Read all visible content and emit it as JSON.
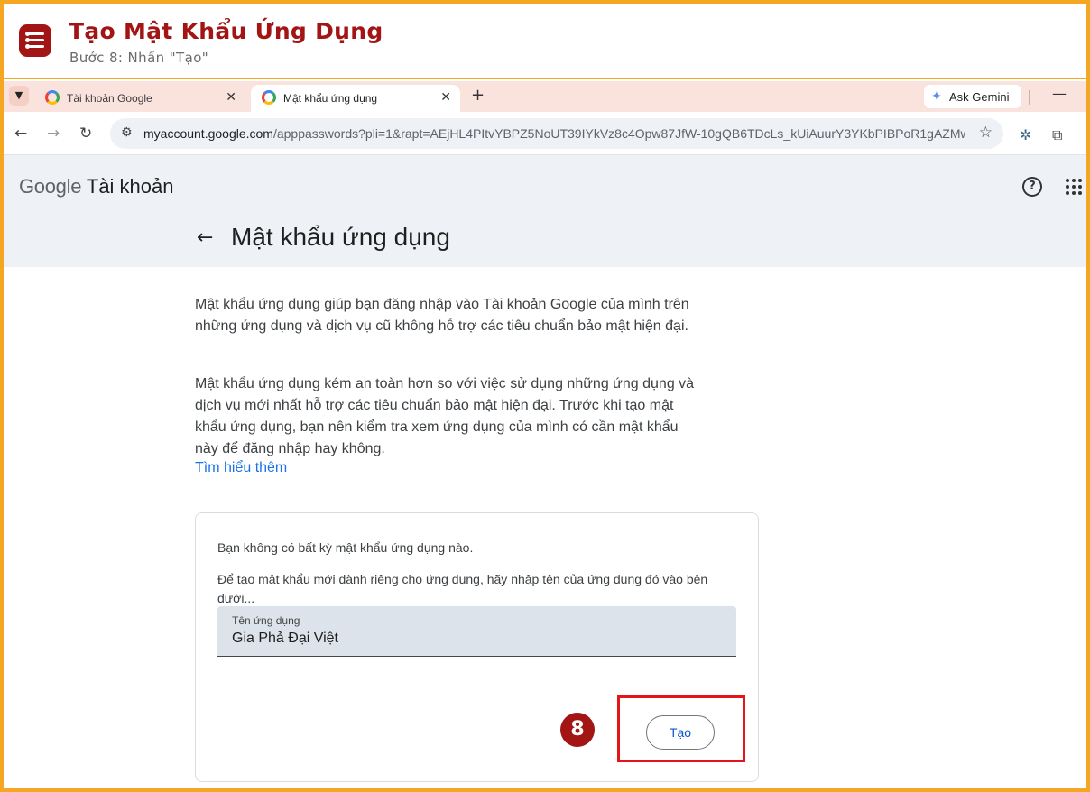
{
  "tutorial": {
    "title": "Tạo Mật Khẩu Ứng Dụng",
    "subtitle": "Bước 8: Nhấn \"Tạo\"",
    "step_number": "8"
  },
  "browser": {
    "tabs": [
      {
        "label": "Tài khoản Google",
        "close": "✕"
      },
      {
        "label": "Mật khẩu ứng dụng",
        "close": "✕"
      }
    ],
    "new_tab": "+",
    "gemini_label": "Ask Gemini",
    "minimize": "—",
    "url_host": "myaccount.google.com",
    "url_path": "/apppasswords?pli=1&rapt=AEjHL4PItvYBPZ5NoUT39IYkVz8c4Opw87JfW-10gQB6TDcLs_kUiAuurY3YKbPIBPoR1gAZMwQ..."
  },
  "header": {
    "brand_google": "Google",
    "brand_account": "Tài khoản",
    "help": "?"
  },
  "page": {
    "title": "Mật khẩu ứng dụng",
    "para1": "Mật khẩu ứng dụng giúp bạn đăng nhập vào Tài khoản Google của mình trên những ứng dụng và dịch vụ cũ không hỗ trợ các tiêu chuẩn bảo mật hiện đại.",
    "para2": "Mật khẩu ứng dụng kém an toàn hơn so với việc sử dụng những ứng dụng và dịch vụ mới nhất hỗ trợ các tiêu chuẩn bảo mật hiện đại. Trước khi tạo mật khẩu ứng dụng, bạn nên kiểm tra xem ứng dụng của mình có cần mật khẩu này để đăng nhập hay không.",
    "learn_more": "Tìm hiểu thêm"
  },
  "card": {
    "no_passwords": "Bạn không có bất kỳ mật khẩu ứng dụng nào.",
    "instructions": "Để tạo mật khẩu mới dành riêng cho ứng dụng, hãy nhập tên của ứng dụng đó vào bên dưới...",
    "field_label": "Tên ứng dụng",
    "field_value": "Gia Phả Đại Việt",
    "create_button": "Tạo"
  },
  "colors": {
    "accent_border": "#f5a623",
    "brand_red": "#a31515",
    "highlight_red": "#e5141a",
    "link_blue": "#1a73e8"
  }
}
